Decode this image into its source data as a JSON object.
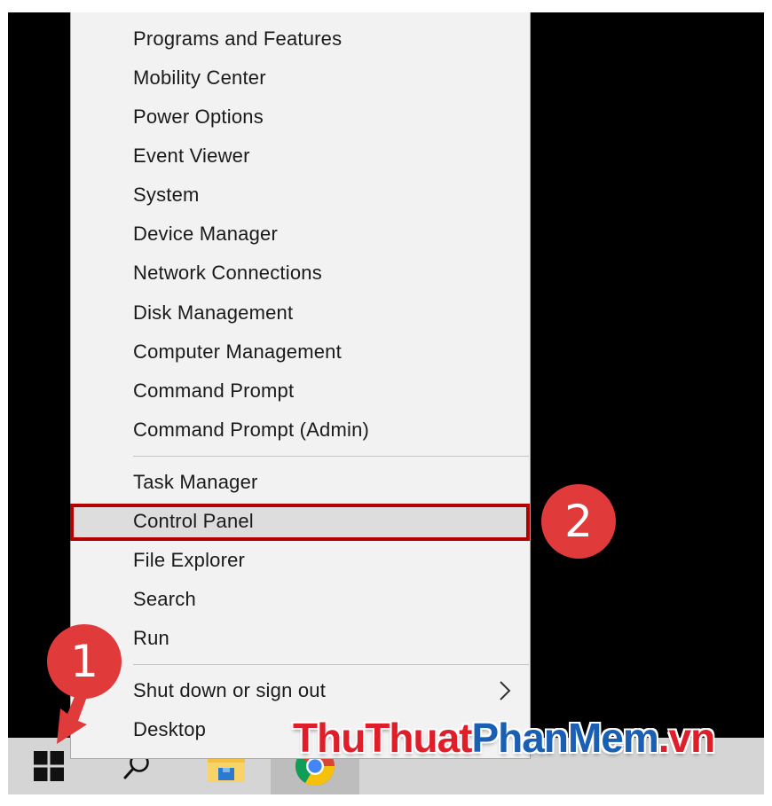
{
  "menu": {
    "groups": [
      [
        "Programs and Features",
        "Mobility Center",
        "Power Options",
        "Event Viewer",
        "System",
        "Device Manager",
        "Network Connections",
        "Disk Management",
        "Computer Management",
        "Command Prompt",
        "Command Prompt (Admin)"
      ],
      [
        "Task Manager",
        "Control Panel",
        "File Explorer",
        "Search",
        "Run"
      ],
      [
        "Shut down or sign out",
        "Desktop"
      ]
    ],
    "highlighted_item": "Control Panel",
    "submenu_item": "Shut down or sign out"
  },
  "annotations": {
    "step1": "1",
    "step2": "2"
  },
  "watermark": {
    "part1": "ThuThuat",
    "part2": "PhanMem",
    "part3": ".vn"
  },
  "taskbar": {
    "icons": [
      "windows-start-icon",
      "search-icon",
      "file-explorer-icon",
      "chrome-icon"
    ]
  },
  "colors": {
    "highlight_border": "#b30000",
    "badge": "#e03a3a",
    "watermark_red": "#e01e2a",
    "watermark_blue": "#1a5fb4"
  }
}
